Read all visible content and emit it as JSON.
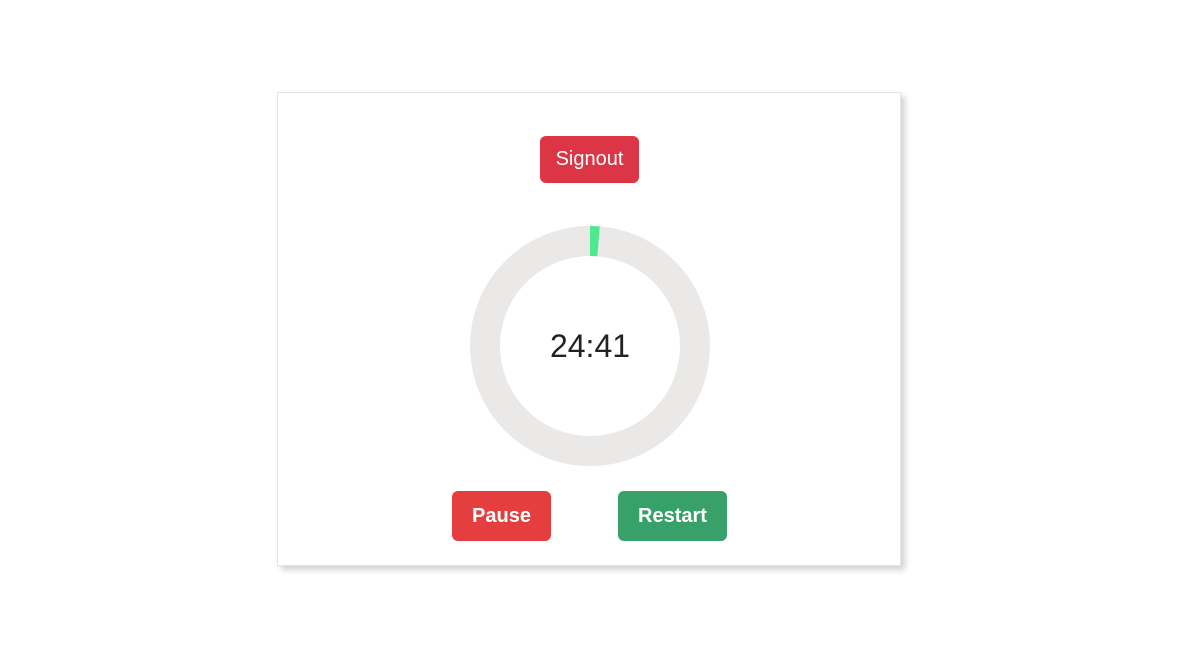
{
  "header": {
    "signout_label": "Signout"
  },
  "timer": {
    "time_display": "24:41",
    "progress_fraction": 0.013,
    "track_color": "#eae9e7",
    "progress_color": "#4ee88f"
  },
  "controls": {
    "pause_label": "Pause",
    "restart_label": "Restart"
  },
  "colors": {
    "signout_bg": "#dc3545",
    "pause_bg": "#e53e3e",
    "restart_bg": "#38a169"
  }
}
